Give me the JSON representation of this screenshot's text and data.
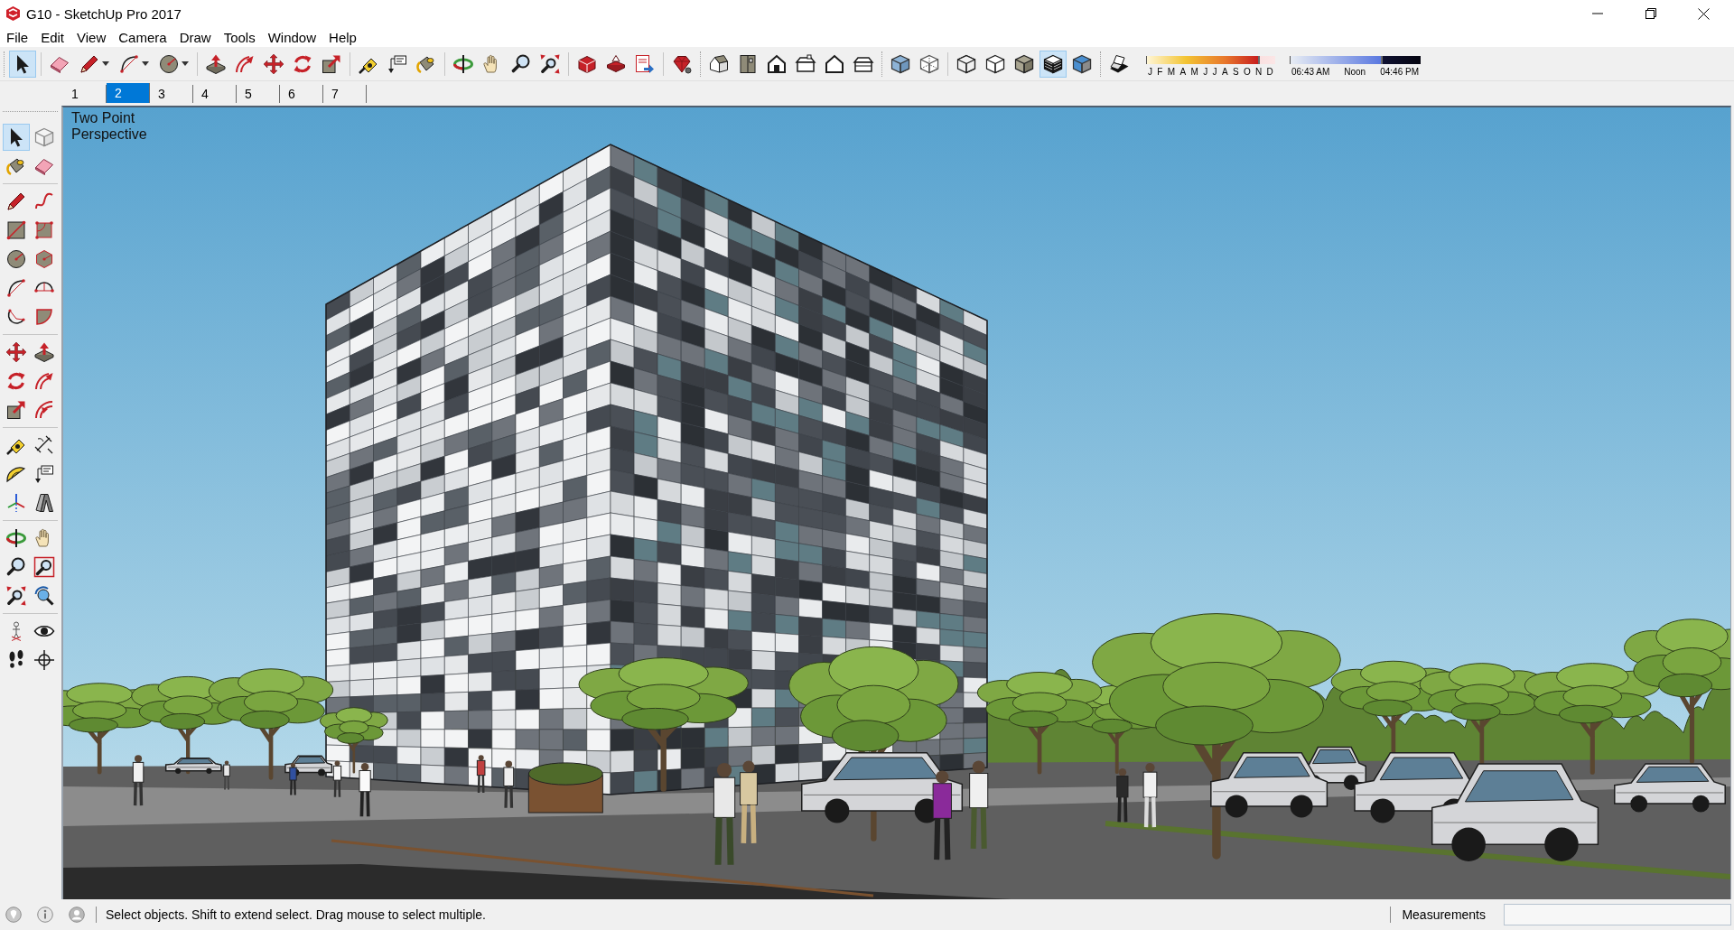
{
  "window": {
    "title": "G10 - SketchUp Pro 2017"
  },
  "menu": [
    "File",
    "Edit",
    "View",
    "Camera",
    "Draw",
    "Tools",
    "Window",
    "Help"
  ],
  "toolbars": [
    {
      "groups": [
        [
          {
            "kind": "select",
            "selected": true
          }
        ],
        [
          {
            "kind": "eraser",
            "selected": false
          },
          {
            "kind": "line",
            "selected": false
          },
          {
            "kind": "arc",
            "selected": false
          },
          {
            "kind": "circle",
            "selected": false
          }
        ],
        [
          {
            "kind": "pushpull",
            "selected": false
          },
          {
            "kind": "followme",
            "selected": false
          },
          {
            "kind": "move",
            "selected": false
          },
          {
            "kind": "rotate",
            "selected": false
          },
          {
            "kind": "scale",
            "selected": false
          }
        ],
        [
          {
            "kind": "tape",
            "selected": false
          },
          {
            "kind": "text",
            "selected": false
          },
          {
            "kind": "paint",
            "selected": false
          }
        ],
        [
          {
            "kind": "orbit",
            "selected": false
          },
          {
            "kind": "pan",
            "selected": false
          },
          {
            "kind": "zoom",
            "selected": false
          },
          {
            "kind": "zoomextents",
            "selected": false
          }
        ],
        [
          {
            "kind": "warehouse",
            "selected": false
          },
          {
            "kind": "share",
            "selected": false
          },
          {
            "kind": "layout",
            "selected": false
          }
        ],
        [
          {
            "kind": "extensions",
            "selected": false
          }
        ]
      ]
    },
    {
      "groups": [
        [
          {
            "kind": "iso",
            "selected": false
          },
          {
            "kind": "top",
            "selected": false
          },
          {
            "kind": "front",
            "selected": false
          },
          {
            "kind": "right",
            "selected": false
          },
          {
            "kind": "back",
            "selected": false
          },
          {
            "kind": "left",
            "selected": false
          }
        ]
      ]
    },
    {
      "groups": [
        [
          {
            "kind": "xray",
            "selected": false
          },
          {
            "kind": "backedges",
            "selected": false
          }
        ],
        [
          {
            "kind": "wireframe",
            "selected": false
          },
          {
            "kind": "hiddenline",
            "selected": false
          },
          {
            "kind": "shaded",
            "selected": false
          },
          {
            "kind": "textured",
            "selected": true
          },
          {
            "kind": "monochrome",
            "selected": false
          }
        ]
      ]
    }
  ],
  "shadow_toolbar": {
    "tools": [
      {
        "kind": "shadows",
        "selected": false
      }
    ],
    "date_slider": {
      "months": [
        "J",
        "F",
        "M",
        "A",
        "M",
        "J",
        "J",
        "A",
        "S",
        "O",
        "N",
        "D"
      ],
      "level": 0.88
    },
    "time_slider": {
      "labels": [
        "06:43 AM",
        "Noon",
        "04:46 PM"
      ],
      "level": 0.71
    }
  },
  "scenes": [
    {
      "label": "1",
      "selected": false
    },
    {
      "label": "2",
      "selected": true
    },
    {
      "label": "3",
      "selected": false
    },
    {
      "label": "4",
      "selected": false
    },
    {
      "label": "5",
      "selected": false
    },
    {
      "label": "6",
      "selected": false
    },
    {
      "label": "7",
      "selected": false
    }
  ],
  "side_toolbar": {
    "groups": [
      [
        {
          "kind": "select",
          "selected": true
        },
        {
          "kind": "component",
          "selected": false
        },
        {
          "kind": "paint",
          "selected": false
        },
        {
          "kind": "eraser",
          "selected": false
        }
      ],
      [
        {
          "kind": "line",
          "selected": false
        },
        {
          "kind": "freehand",
          "selected": false
        },
        {
          "kind": "rectangle",
          "selected": false
        },
        {
          "kind": "rotrect",
          "selected": false
        },
        {
          "kind": "circle",
          "selected": false
        },
        {
          "kind": "polygon",
          "selected": false
        },
        {
          "kind": "arc",
          "selected": false
        },
        {
          "kind": "arc2",
          "selected": false
        },
        {
          "kind": "arc3",
          "selected": false
        },
        {
          "kind": "pie",
          "selected": false
        }
      ],
      [
        {
          "kind": "move",
          "selected": false
        },
        {
          "kind": "pushpull",
          "selected": false
        },
        {
          "kind": "rotate",
          "selected": false
        },
        {
          "kind": "followme",
          "selected": false
        },
        {
          "kind": "scale",
          "selected": false
        },
        {
          "kind": "offset",
          "selected": false
        }
      ],
      [
        {
          "kind": "tape",
          "selected": false
        },
        {
          "kind": "dimension",
          "selected": false
        },
        {
          "kind": "protractor",
          "selected": false
        },
        {
          "kind": "text",
          "selected": false
        },
        {
          "kind": "axes",
          "selected": false
        },
        {
          "kind": "text3d",
          "selected": false
        }
      ],
      [
        {
          "kind": "orbit",
          "selected": false
        },
        {
          "kind": "pan",
          "selected": false
        },
        {
          "kind": "zoom",
          "selected": false
        },
        {
          "kind": "zoomwindow",
          "selected": false
        },
        {
          "kind": "zoomextents",
          "selected": false
        },
        {
          "kind": "previous",
          "selected": false
        }
      ],
      [
        {
          "kind": "position",
          "selected": false
        },
        {
          "kind": "lookaround",
          "selected": false
        },
        {
          "kind": "walk",
          "selected": false
        },
        {
          "kind": "section",
          "selected": false
        }
      ]
    ]
  },
  "viewport": {
    "camera_label": "Two Point Perspective"
  },
  "status_bar": {
    "hint": "Select objects. Shift to extend select. Drag mouse to select multiple.",
    "measurements_label": "Measurements"
  }
}
